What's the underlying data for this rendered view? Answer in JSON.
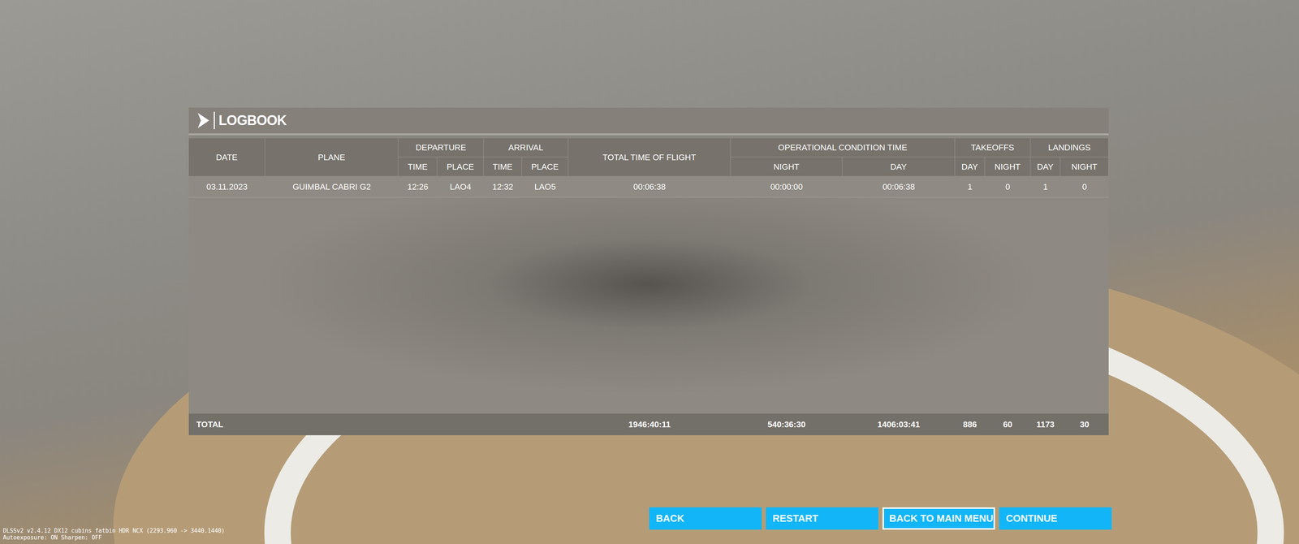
{
  "logbook": {
    "title": "LOGBOOK",
    "columns": [
      {
        "label": "DATE",
        "sub": []
      },
      {
        "label": "PLANE",
        "sub": []
      },
      {
        "label": "DEPARTURE",
        "sub": [
          "TIME",
          "PLACE"
        ]
      },
      {
        "label": "ARRIVAL",
        "sub": [
          "TIME",
          "PLACE"
        ]
      },
      {
        "label": "TOTAL TIME OF FLIGHT",
        "sub": []
      },
      {
        "label": "OPERATIONAL CONDITION TIME",
        "sub": [
          "NIGHT",
          "DAY"
        ]
      },
      {
        "label": "TAKEOFFS",
        "sub": [
          "DAY",
          "NIGHT"
        ]
      },
      {
        "label": "LANDINGS",
        "sub": [
          "DAY",
          "NIGHT"
        ]
      }
    ],
    "rows": [
      [
        "03.11.2023",
        "GUIMBAL CABRI G2",
        "12:26",
        "LAO4",
        "12:32",
        "LAO5",
        "00:06:38",
        "00:00:00",
        "00:06:38",
        "1",
        "0",
        "1",
        "0"
      ]
    ],
    "total": {
      "label": "TOTAL",
      "values": [
        "1946:40:11",
        "540:36:30",
        "1406:03:41",
        "886",
        "60",
        "1173",
        "30"
      ]
    }
  },
  "buttons": [
    {
      "label": "BACK",
      "selected": false
    },
    {
      "label": "RESTART",
      "selected": false
    },
    {
      "label": "BACK TO MAIN MENU",
      "selected": true
    },
    {
      "label": "CONTINUE",
      "selected": false
    }
  ],
  "debug_overlay": [
    "DLSSv2 v2.4.12 DX12 cubins fatbin HDR NCX (2293.960 -> 3440.1440)",
    "Autoexposure: ON Sharpen: OFF"
  ]
}
